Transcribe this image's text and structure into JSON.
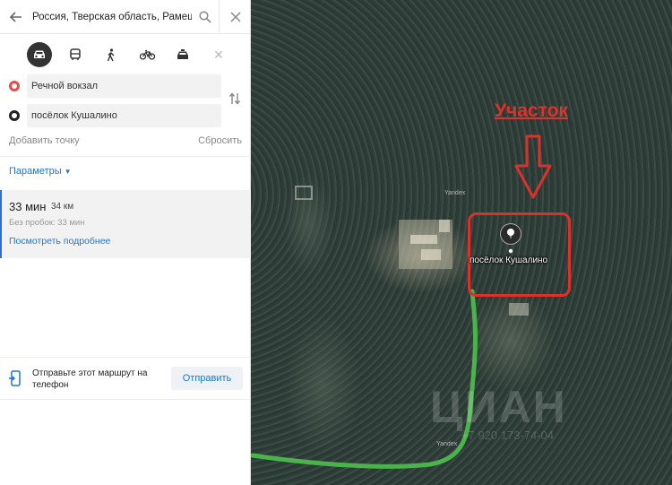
{
  "search": {
    "value": "Россия, Тверская область, Рамешковский район"
  },
  "modes": [
    {
      "name": "car-icon",
      "active": true
    },
    {
      "name": "bus-icon",
      "active": false
    },
    {
      "name": "pedestrian-icon",
      "active": false
    },
    {
      "name": "bicycle-icon",
      "active": false
    },
    {
      "name": "taxi-icon",
      "active": false
    }
  ],
  "route": {
    "from": "Речной вокзал",
    "to": "посёлок Кушалино",
    "add_point": "Добавить точку",
    "reset": "Сбросить",
    "params": "Параметры"
  },
  "result": {
    "time": "33 мин",
    "distance": "34 км",
    "no_traffic": "Без пробок: 33 мин",
    "details": "Посмотреть подробнее"
  },
  "send": {
    "text": "Отправьте этот маршрут на телефон",
    "button": "Отправить"
  },
  "map": {
    "plot_label": "Участок",
    "place_label": "посёлок Кушалино",
    "yandex_mark": "Yandex",
    "watermark": "ЦИАН",
    "watermark_phone": "+7 920 173-74-04",
    "route_color": "#4bb34b",
    "highlight_color": "#d9322a"
  }
}
